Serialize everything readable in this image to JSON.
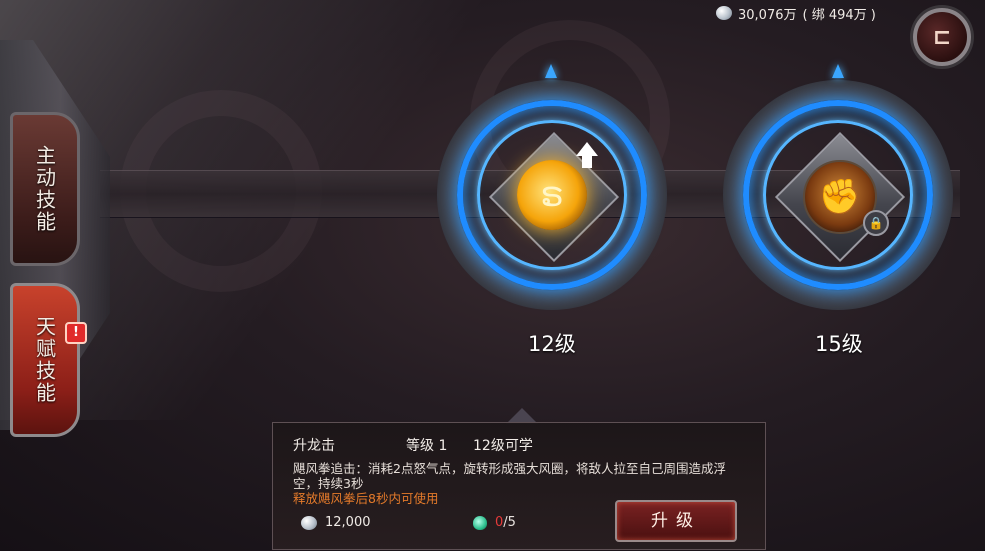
{
  "currency": {
    "amount": "30,076万",
    "bound": "( 绑 494万 )",
    "icon": "silver-gem-icon"
  },
  "back_button": {
    "glyph": "⊏"
  },
  "tabs": [
    {
      "label": "主动技能",
      "state": "inactive"
    },
    {
      "label": "天赋技能",
      "state": "active",
      "alert": "!"
    }
  ],
  "skills": [
    {
      "level_label": "12级",
      "icon": "golden-dragon-icon",
      "upgradable": true
    },
    {
      "level_label": "15级",
      "icon": "fist-icon",
      "locked": true
    }
  ],
  "info": {
    "name": "升龙击",
    "level": "等级 1",
    "learn_req": "12级可学",
    "description": "飓风拳追击：消耗2点怒气点，旋转形成强大风圈，将敌人拉至自己周围造成浮空，持续3秒",
    "condition": "释放飓风拳后8秒内可使用",
    "cost": "12,000",
    "material_have": "0",
    "material_need": "/5",
    "upgrade_label": "升级"
  },
  "colors": {
    "glow_blue": "#1f8cff",
    "condition_orange": "#e47a2a",
    "material_red": "#e63a3a"
  }
}
